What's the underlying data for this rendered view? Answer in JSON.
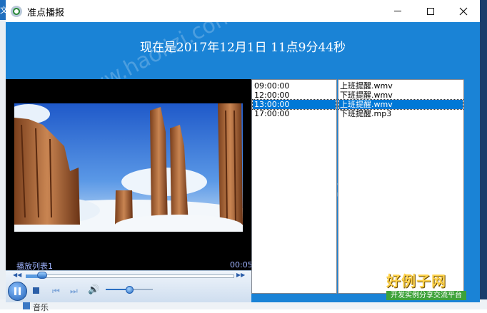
{
  "desktop": {
    "left_text": "文",
    "bottom_text": "音乐"
  },
  "window": {
    "title": "准点播报",
    "controls": {
      "minimize": "—",
      "maximize": "☐",
      "close": "✕"
    }
  },
  "header": {
    "datetime_text": "现在是2017年12月1日  11点9分44秒"
  },
  "player": {
    "playlist_label": "播放列表1",
    "elapsed": "00:05",
    "seek_progress": 0.08,
    "volume_level": 0.5
  },
  "schedule": {
    "times": [
      "09:00:00",
      "12:00:00",
      "13:00:00",
      "17:00:00"
    ],
    "files": [
      "上班提醒.wmv",
      "下班提醒.wmv",
      "上班提醒.wmv",
      "下班提醒.mp3"
    ],
    "selected_index": 2
  },
  "watermark": {
    "text": "www.haolizi.com",
    "logo_main": "好例子网",
    "logo_sub": "开发实例分享交流平台"
  },
  "colors": {
    "client_bg": "#1a83d6",
    "selection": "#0078d7"
  },
  "icons": [
    "app-icon",
    "minimize-icon",
    "maximize-icon",
    "close-icon",
    "play-pause-icon",
    "stop-icon",
    "previous-icon",
    "next-icon",
    "volume-icon",
    "seek-back-icon",
    "seek-forward-icon"
  ]
}
